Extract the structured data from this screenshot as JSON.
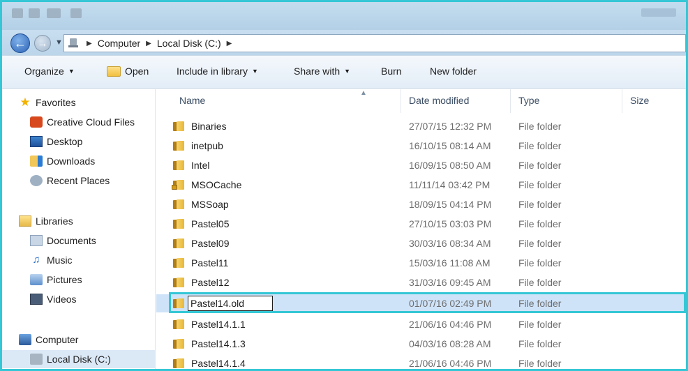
{
  "address": {
    "crumbs": [
      "Computer",
      "Local Disk (C:)"
    ]
  },
  "toolbar": {
    "organize": "Organize",
    "open": "Open",
    "include_in_library": "Include in library",
    "share_with": "Share with",
    "burn": "Burn",
    "new_folder": "New folder"
  },
  "navpane": {
    "favorites": {
      "label": "Favorites",
      "items": [
        "Creative Cloud Files",
        "Desktop",
        "Downloads",
        "Recent Places"
      ]
    },
    "libraries": {
      "label": "Libraries",
      "items": [
        "Documents",
        "Music",
        "Pictures",
        "Videos"
      ]
    },
    "computer": {
      "label": "Computer",
      "items": [
        "Local Disk (C:)"
      ]
    }
  },
  "columns": {
    "name": "Name",
    "date_modified": "Date modified",
    "type": "Type",
    "size": "Size"
  },
  "files": [
    {
      "name": "Binaries",
      "date": "27/07/15 12:32 PM",
      "type": "File folder"
    },
    {
      "name": "inetpub",
      "date": "16/10/15 08:14 AM",
      "type": "File folder"
    },
    {
      "name": "Intel",
      "date": "16/09/15 08:50 AM",
      "type": "File folder"
    },
    {
      "name": "MSOCache",
      "date": "11/11/14 03:42 PM",
      "type": "File folder"
    },
    {
      "name": "MSSoap",
      "date": "18/09/15 04:14 PM",
      "type": "File folder"
    },
    {
      "name": "Pastel05",
      "date": "27/10/15 03:03 PM",
      "type": "File folder"
    },
    {
      "name": "Pastel09",
      "date": "30/03/16 08:34 AM",
      "type": "File folder"
    },
    {
      "name": "Pastel11",
      "date": "15/03/16 11:08 AM",
      "type": "File folder"
    },
    {
      "name": "Pastel12",
      "date": "31/03/16 09:45 AM",
      "type": "File folder"
    },
    {
      "name": "Pastel14.old",
      "date": "01/07/16 02:49 PM",
      "type": "File folder"
    },
    {
      "name": "Pastel14.1.1",
      "date": "21/06/16 04:46 PM",
      "type": "File folder"
    },
    {
      "name": "Pastel14.1.3",
      "date": "04/03/16 08:28 AM",
      "type": "File folder"
    },
    {
      "name": "Pastel14.1.4",
      "date": "21/06/16 04:46 PM",
      "type": "File folder"
    }
  ],
  "colors": {
    "highlight": "#35c7d6",
    "selected_row": "#cfe3f8"
  }
}
